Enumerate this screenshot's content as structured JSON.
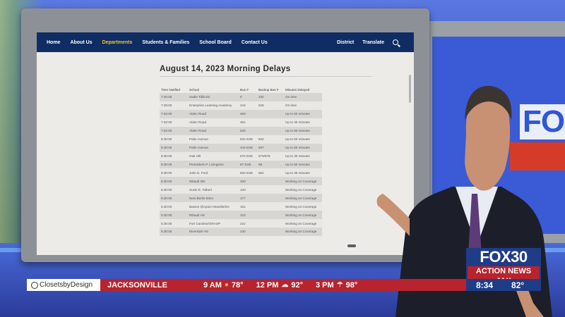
{
  "website": {
    "nav": [
      "Home",
      "About Us",
      "Departments",
      "Students & Families",
      "School Board",
      "Contact Us"
    ],
    "nav_active_index": 2,
    "nav_right": [
      "District",
      "Translate"
    ],
    "page_title": "August 14, 2023 Morning Delays",
    "table_headers": [
      "Time Notified",
      "School",
      "Bus #",
      "Backup Bus #",
      "Minutes Delayed"
    ],
    "rows": [
      [
        "7:40:00",
        "Sadie Tillis ES",
        "9",
        "330",
        "On time"
      ],
      [
        "7:49:00",
        "Enterprise Learning Academy",
        "244",
        "526",
        "On time"
      ],
      [
        "7:02:00",
        "Alden Road",
        "450",
        "",
        "Up to 60 minutes"
      ],
      [
        "7:02:00",
        "Alden Road",
        "461",
        "",
        "Up to 30 minutes"
      ],
      [
        "7:02:00",
        "Alden Road",
        "520",
        "",
        "Up to 60 minutes"
      ],
      [
        "5:30:00",
        "Palm Avenue",
        "632 ESE",
        "632",
        "Up to 60 minutes"
      ],
      [
        "5:30:00",
        "Palm Avenue",
        "444 ESE",
        "937",
        "Up to 60 minutes"
      ],
      [
        "5:30:00",
        "Oak Hill",
        "676 ESE",
        "675/676",
        "Up to 30 minutes"
      ],
      [
        "5:30:00",
        "Pineside/S.P. Livingston",
        "87 ESE",
        "98",
        "Up to 60 minutes"
      ],
      [
        "5:30:00",
        "John E. Ford",
        "502 ESE",
        "681",
        "Up to 30 minutes"
      ],
      [
        "5:30:00",
        "Ribault MS",
        "300",
        "",
        "Working on Coverage"
      ],
      [
        "5:30:00",
        "Susie E. Tolbert",
        "100",
        "",
        "Working on Coverage"
      ],
      [
        "5:30:00",
        "New Berlin Elem",
        "177",
        "",
        "Working on Coverage"
      ],
      [
        "5:30:00",
        "Baines @Aptx/J Wardist/DA",
        "161",
        "",
        "Working on Coverage"
      ],
      [
        "5:30:00",
        "Ribault HS",
        "215",
        "",
        "Working on Coverage"
      ],
      [
        "5:30:00",
        "Fort Caroline/GRASP",
        "222",
        "",
        "Working on Coverage"
      ],
      [
        "5:30:00",
        "Riverside HS",
        "240",
        "",
        "Working on Coverage"
      ]
    ]
  },
  "broadcast": {
    "sponsor": "ClosetsbyDesign",
    "city": "JACKSONVILLE",
    "forecast": [
      {
        "time": "9 AM",
        "icon": "sun-icon",
        "temp": "78°"
      },
      {
        "time": "12 PM",
        "icon": "partly-cloudy-icon",
        "temp": "92°"
      },
      {
        "time": "3 PM",
        "icon": "storm-icon",
        "temp": "98°"
      }
    ],
    "clock": "8:34",
    "current_temp": "82°",
    "station_logo": "FOX30",
    "station_sub": "ACTION NEWS JAX"
  },
  "colors": {
    "nav_bg": "#0f2d63",
    "nav_active": "#f2c230",
    "ticker_red": "#b8232d",
    "station_blue": "#1f3c88"
  }
}
